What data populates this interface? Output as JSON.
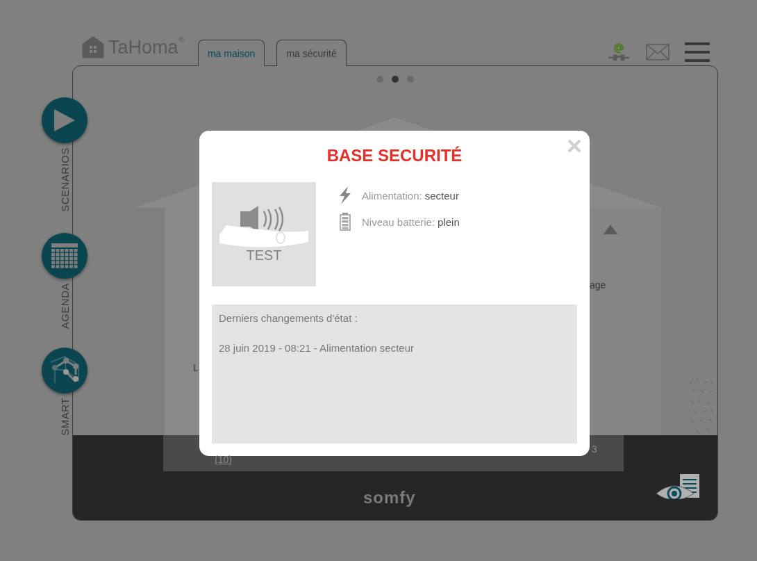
{
  "logo": {
    "text": "TaHoma",
    "mark": "®"
  },
  "tabs": [
    {
      "label": "ma maison",
      "selected": true
    },
    {
      "label": "ma sécurité",
      "selected": false
    }
  ],
  "carousel_dots": [
    {
      "selected": false
    },
    {
      "selected": true
    },
    {
      "selected": false
    }
  ],
  "side_nav": [
    {
      "label": "SCENARIOS",
      "kind": "play"
    },
    {
      "label": "AGENDA",
      "kind": "calendar"
    },
    {
      "label": "SMART",
      "kind": "network"
    }
  ],
  "background_texts": [
    "age",
    "L",
    "3",
    "(10)"
  ],
  "footer": {
    "brand": "somfy"
  },
  "dialog": {
    "title": "BASE SECURITÉ",
    "image_label": "TEST",
    "info": [
      {
        "kind": "power",
        "label": "Alimentation:",
        "value": "secteur"
      },
      {
        "kind": "battery",
        "label": "Niveau batterie:",
        "value": "plein"
      }
    ],
    "history": {
      "heading": "Derniers changements d'état :",
      "entries": [
        "28 juin 2019 - 08:21 - Alimentation secteur"
      ]
    }
  }
}
